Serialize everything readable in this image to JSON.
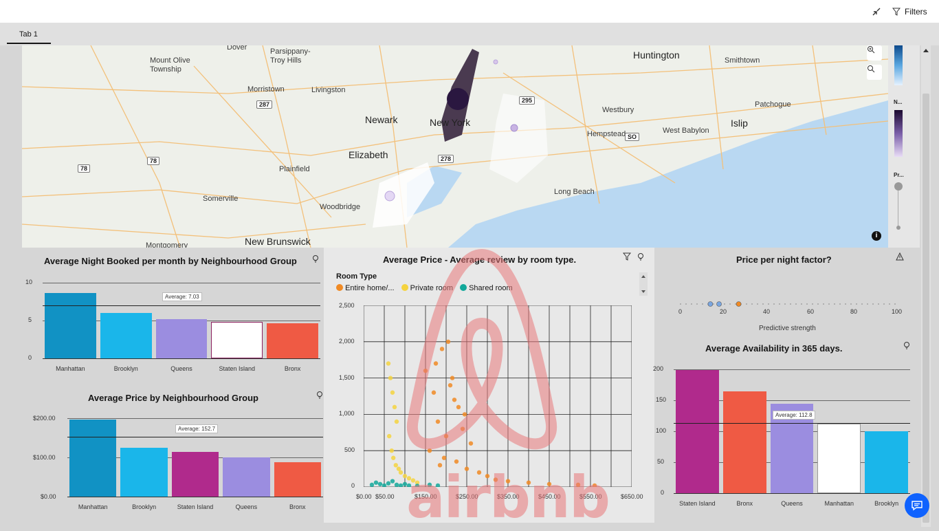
{
  "topbar": {
    "filters_label": "Filters"
  },
  "tabs": [
    {
      "label": "Tab 1"
    }
  ],
  "map": {
    "places": [
      {
        "name": "Dover"
      },
      {
        "name": "Parsippany-\nTroy Hills"
      },
      {
        "name": "Mount Olive\nTownship"
      },
      {
        "name": "Huntington"
      },
      {
        "name": "Smithtown"
      },
      {
        "name": "Morristown"
      },
      {
        "name": "Livingston"
      },
      {
        "name": "Westbury"
      },
      {
        "name": "Patchogue"
      },
      {
        "name": "Newark"
      },
      {
        "name": "New York"
      },
      {
        "name": "Hempstead"
      },
      {
        "name": "West Babylon"
      },
      {
        "name": "Islip"
      },
      {
        "name": "Elizabeth"
      },
      {
        "name": "Plainfield"
      },
      {
        "name": "Long Beach"
      },
      {
        "name": "Somerville"
      },
      {
        "name": "Woodbridge"
      },
      {
        "name": "Montgomery"
      },
      {
        "name": "New Brunswick"
      }
    ],
    "shields": [
      "287",
      "295",
      "278",
      "78",
      "78",
      "SO"
    ],
    "legend_labels": [
      "N...",
      "Pr..."
    ],
    "info_label": "i"
  },
  "night_chart": {
    "title": "Average Night Booked per month by Neighbourhood Group",
    "y_ticks": [
      "10",
      "5",
      "0"
    ],
    "average_label": "Average: 7.03"
  },
  "price_chart": {
    "title": "Average Price by Neighbourhood Group",
    "y_ticks": [
      "$200.00",
      "$100.00",
      "$0.00"
    ],
    "average_label": "Average: 152.7"
  },
  "scatter": {
    "title": "Average Price - Average review by room type.",
    "legend_title": "Room Type",
    "legend": [
      {
        "label": "Entire home/...",
        "color": "#f08a24"
      },
      {
        "label": "Private room",
        "color": "#f5d33f"
      },
      {
        "label": "Shared room",
        "color": "#12a89a"
      }
    ],
    "y_ticks": [
      "2,500",
      "2,000",
      "1,500",
      "1,000",
      "500",
      "0"
    ],
    "x_ticks": [
      "$0.00",
      "$50.00",
      "$150.00",
      "$250.00",
      "$350.00",
      "$450.00",
      "$550.00",
      "$650.00"
    ],
    "watermark": "airbnb"
  },
  "factor": {
    "title": "Price per night factor?",
    "ticks": [
      "0",
      "20",
      "40",
      "60",
      "80",
      "100"
    ],
    "xlabel": "Predictive strength"
  },
  "avail_chart": {
    "title": "Average Availability in 365 days.",
    "y_ticks": [
      "200",
      "150",
      "100",
      "50",
      "0"
    ],
    "average_label": "Average: 112.8"
  },
  "chart_data": [
    {
      "type": "bar",
      "title": "Average Night Booked per month by Neighbourhood Group",
      "categories": [
        "Manhattan",
        "Brooklyn",
        "Queens",
        "Staten Island",
        "Bronx"
      ],
      "values": [
        8.6,
        6.0,
        5.2,
        4.8,
        4.6
      ],
      "colors": [
        "#1192c4",
        "#1ab6ea",
        "#9b8de0",
        "#ffffff",
        "#ef5a44"
      ],
      "ylim": [
        0,
        10
      ],
      "average": 7.03
    },
    {
      "type": "bar",
      "title": "Average Price by Neighbourhood Group",
      "categories": [
        "Manhattan",
        "Brooklyn",
        "Staten Island",
        "Queens",
        "Bronx"
      ],
      "values": [
        197,
        124,
        114,
        100,
        88
      ],
      "colors": [
        "#1192c4",
        "#1ab6ea",
        "#b02a8c",
        "#9b8de0",
        "#ef5a44"
      ],
      "ylim": [
        0,
        200
      ],
      "average": 152.7
    },
    {
      "type": "bar",
      "title": "Average Availability in 365 days.",
      "categories": [
        "Staten Island",
        "Bronx",
        "Queens",
        "Manhattan",
        "Brooklyn"
      ],
      "values": [
        199,
        165,
        144,
        112,
        100
      ],
      "colors": [
        "#b02a8c",
        "#ef5a44",
        "#9b8de0",
        "#ffffff",
        "#1ab6ea"
      ],
      "ylim": [
        0,
        200
      ],
      "average": 112.8
    },
    {
      "type": "scatter",
      "title": "Average Price - Average review by room type.",
      "xlim": [
        0,
        650
      ],
      "ylim": [
        0,
        2500
      ],
      "series": [
        {
          "name": "Entire home/...",
          "x": [
            150,
            170,
            190,
            210,
            230,
            180,
            200,
            220,
            240,
            260,
            160,
            175,
            205,
            215,
            245,
            195,
            185,
            225,
            250,
            280,
            300,
            320,
            350,
            400,
            450,
            520,
            560
          ],
          "y": [
            1600,
            1300,
            1900,
            1400,
            1100,
            900,
            700,
            1200,
            800,
            600,
            500,
            1700,
            2000,
            1500,
            1000,
            400,
            300,
            350,
            250,
            200,
            150,
            100,
            80,
            60,
            40,
            30,
            20
          ]
        },
        {
          "name": "Private room",
          "x": [
            60,
            65,
            70,
            75,
            80,
            62,
            68,
            72,
            78,
            85,
            90,
            100,
            110,
            120,
            130
          ],
          "y": [
            1700,
            1500,
            1300,
            1100,
            900,
            700,
            500,
            400,
            300,
            250,
            200,
            150,
            120,
            90,
            60
          ]
        },
        {
          "name": "Shared room",
          "x": [
            20,
            30,
            40,
            50,
            60,
            70,
            80,
            90,
            100,
            110,
            130,
            160,
            180
          ],
          "y": [
            30,
            60,
            40,
            20,
            50,
            80,
            30,
            20,
            40,
            20,
            15,
            30,
            20
          ]
        }
      ]
    },
    {
      "type": "scatter",
      "title": "Price per night factor?",
      "xlabel": "Predictive strength",
      "xlim": [
        0,
        100
      ],
      "series": [
        {
          "x": [
            14,
            18,
            27
          ],
          "y": [
            0,
            0,
            0
          ]
        }
      ]
    }
  ]
}
